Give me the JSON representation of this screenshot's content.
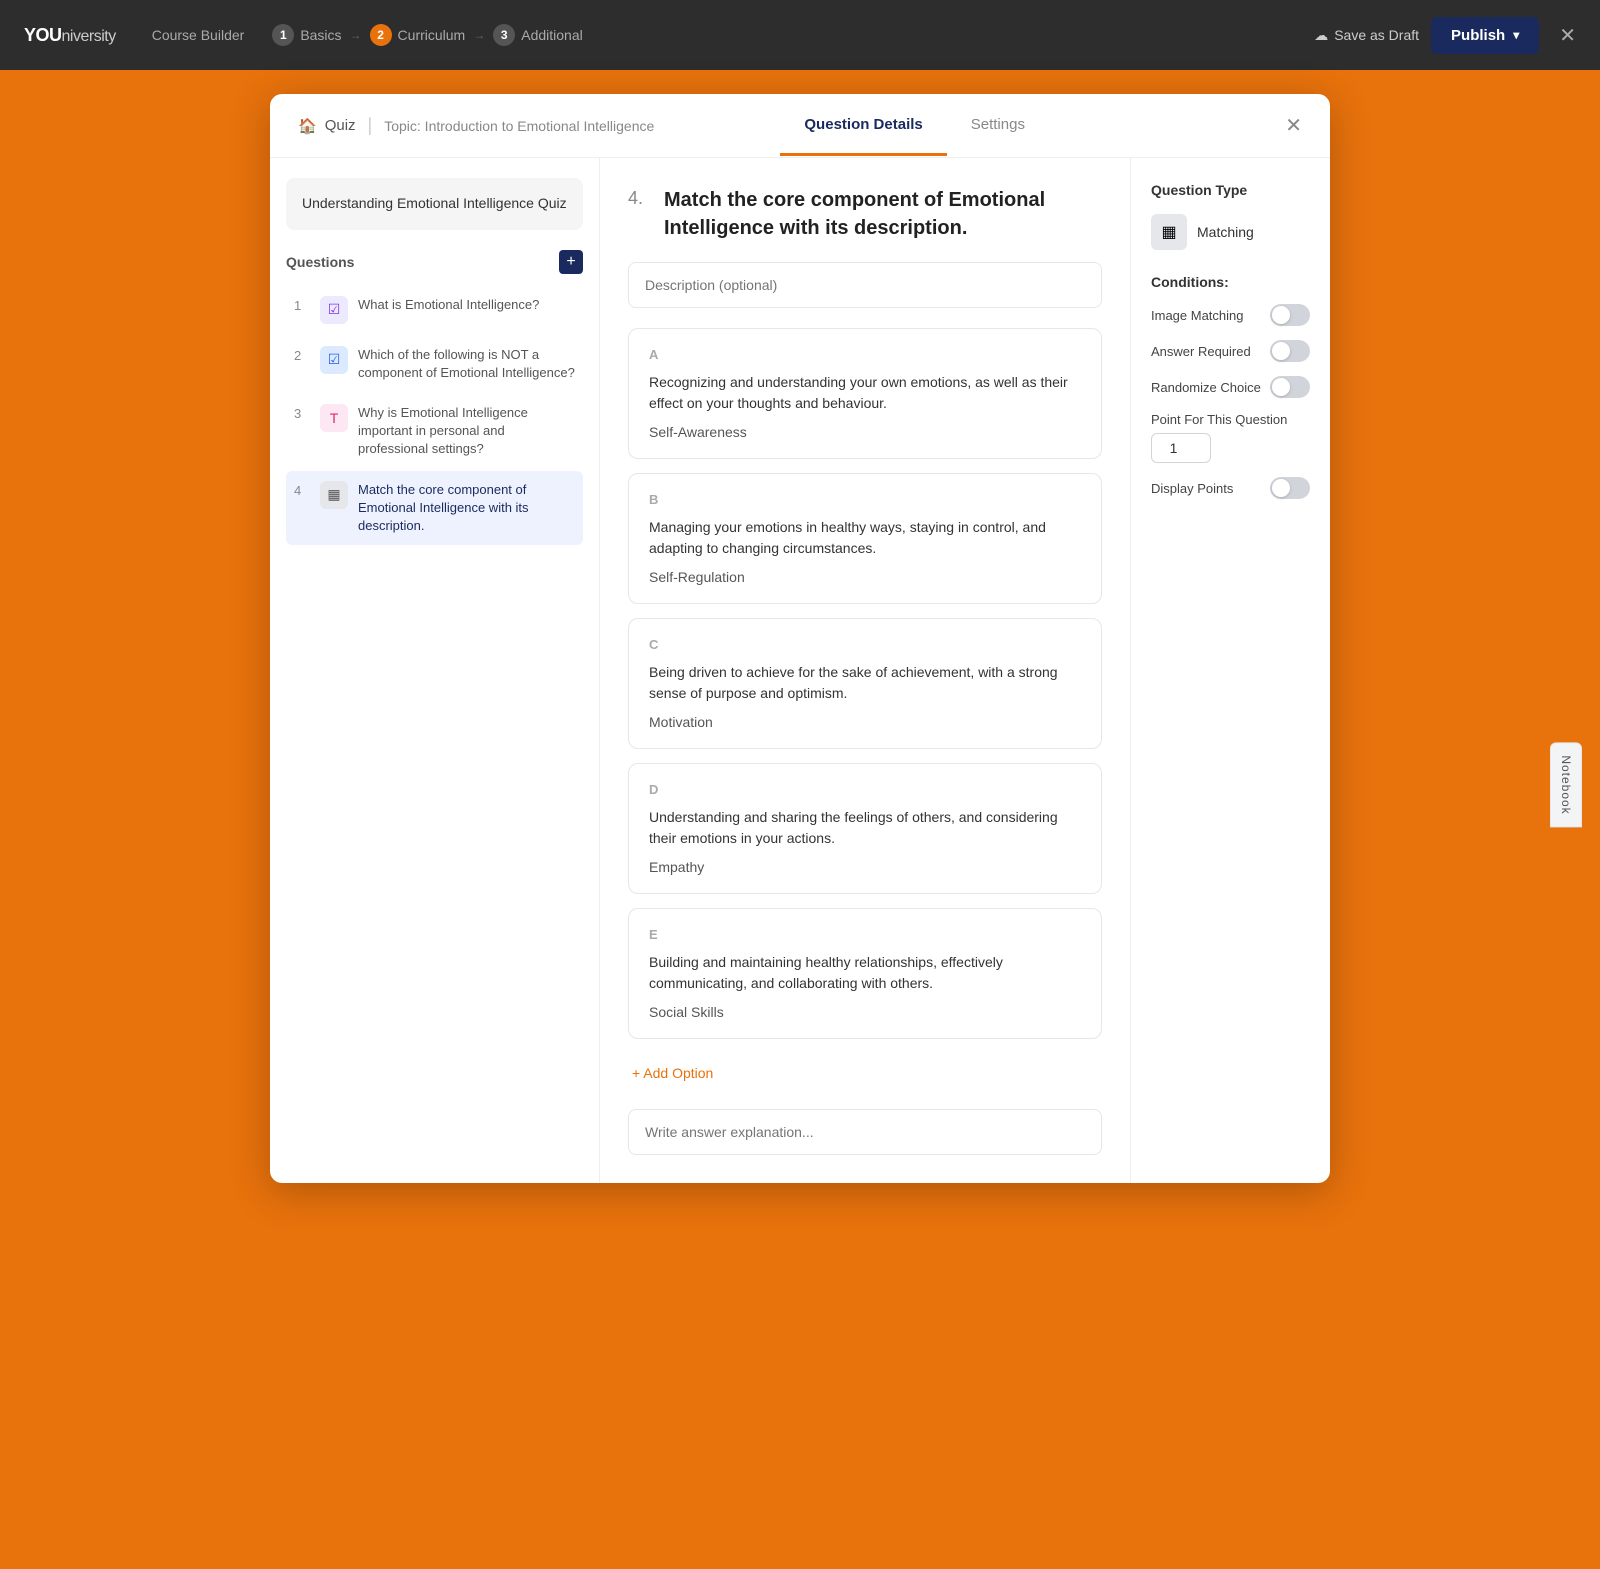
{
  "topNav": {
    "logo_you": "YOU",
    "logo_niversity": "niversity",
    "course_builder_label": "Course Builder",
    "steps": [
      {
        "num": "1",
        "label": "Basics",
        "active": false
      },
      {
        "num": "2",
        "label": "Curriculum",
        "active": true
      },
      {
        "num": "3",
        "label": "Additional",
        "active": false
      }
    ],
    "save_draft_label": "Save as Draft",
    "publish_label": "Publish",
    "close_label": "✕"
  },
  "modal": {
    "quiz_icon": "🏠",
    "quiz_label": "Quiz",
    "topic_label": "Topic: Introduction to Emotional Intelligence",
    "tabs": [
      {
        "label": "Question Details",
        "active": true
      },
      {
        "label": "Settings",
        "active": false
      }
    ],
    "close_label": "✕"
  },
  "sidebar": {
    "quiz_title": "Understanding Emotional Intelligence Quiz",
    "questions_label": "Questions",
    "add_label": "+",
    "questions": [
      {
        "num": "1",
        "icon": "☑",
        "icon_type": "purple",
        "text": "What is Emotional Intelligence?"
      },
      {
        "num": "2",
        "icon": "☑",
        "icon_type": "blue-check",
        "text": "Which of the following is NOT a component of Emotional Intelligence?"
      },
      {
        "num": "3",
        "icon": "T",
        "icon_type": "pink",
        "text": "Why is Emotional Intelligence important in personal and professional settings?"
      },
      {
        "num": "4",
        "icon": "▦",
        "icon_type": "gray",
        "text": "Match the core component of Emotional Intelligence with its description.",
        "active": true
      }
    ]
  },
  "questionDetail": {
    "number": "4.",
    "title": "Match the core component of Emotional Intelligence with its description.",
    "description_placeholder": "Description (optional)",
    "options": [
      {
        "letter": "A",
        "content": "Recognizing and understanding your own emotions, as well as their effect on your thoughts and behaviour.",
        "match_label": "Self-Awareness"
      },
      {
        "letter": "B",
        "content": "Managing your emotions in healthy ways, staying in control, and adapting to changing circumstances.",
        "match_label": "Self-Regulation"
      },
      {
        "letter": "C",
        "content": "Being driven to achieve for the sake of achievement, with a strong sense of purpose and optimism.",
        "match_label": "Motivation"
      },
      {
        "letter": "D",
        "content": "Understanding and sharing the feelings of others, and considering their emotions in your actions.",
        "match_label": "Empathy"
      },
      {
        "letter": "E",
        "content": "Building and maintaining healthy relationships, effectively communicating, and collaborating with others.",
        "match_label": "Social Skills"
      }
    ],
    "add_option_label": "+ Add Option",
    "answer_explanation_placeholder": "Write answer explanation..."
  },
  "rightPanel": {
    "question_type_label": "Question Type",
    "question_type": "Matching",
    "question_type_icon": "▦",
    "conditions_label": "Conditions:",
    "conditions": [
      {
        "label": "Image Matching",
        "enabled": false
      },
      {
        "label": "Answer Required",
        "enabled": false
      },
      {
        "label": "Randomize Choice",
        "enabled": false
      }
    ],
    "point_label": "Point For This Question",
    "point_value": "1",
    "display_points_label": "Display Points",
    "display_points_enabled": false
  },
  "notebook": {
    "label": "Notebook"
  }
}
